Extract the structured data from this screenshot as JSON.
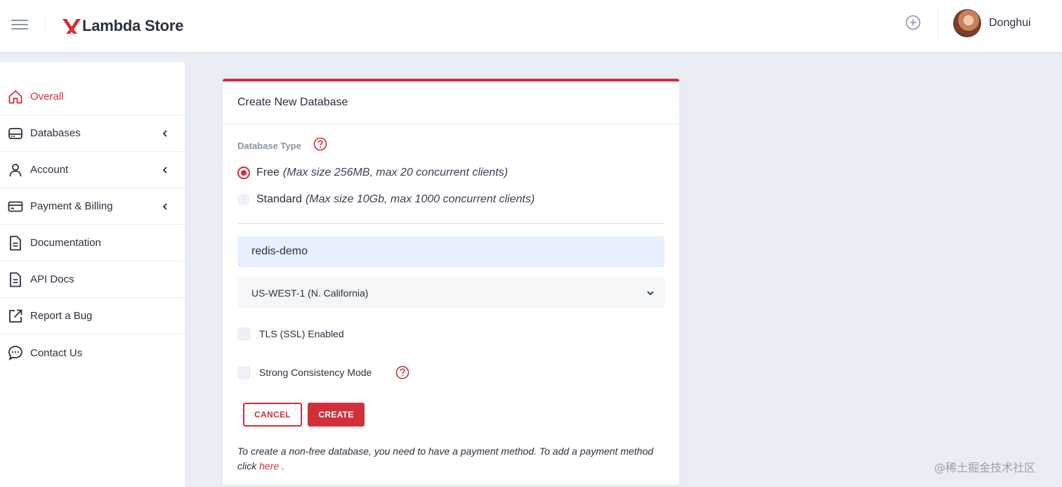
{
  "colors": {
    "accent": "#d1303b",
    "background": "#eaedf4",
    "text": "#2b3140"
  },
  "header": {
    "menu_icon": "hamburger-icon",
    "app_name": "Lambda Store",
    "add_icon": "plus-circle-icon",
    "user_name": "Donghui"
  },
  "sidebar": {
    "items": [
      {
        "label": "Overall",
        "icon": "home-icon",
        "active": true,
        "expandable": false
      },
      {
        "label": "Databases",
        "icon": "database-icon",
        "active": false,
        "expandable": true
      },
      {
        "label": "Account",
        "icon": "user-icon",
        "active": false,
        "expandable": true
      },
      {
        "label": "Payment & Billing",
        "icon": "credit-card-icon",
        "active": false,
        "expandable": true
      },
      {
        "label": "Documentation",
        "icon": "document-icon",
        "active": false,
        "expandable": false
      },
      {
        "label": "API Docs",
        "icon": "document-icon",
        "active": false,
        "expandable": false
      },
      {
        "label": "Report a Bug",
        "icon": "external-link-icon",
        "active": false,
        "expandable": false
      },
      {
        "label": "Contact Us",
        "icon": "chat-icon",
        "active": false,
        "expandable": false
      }
    ]
  },
  "form": {
    "title": "Create New Database",
    "type_label": "Database Type",
    "types": [
      {
        "name": "Free",
        "description": "(Max size 256MB, max 20 concurrent clients)",
        "selected": true
      },
      {
        "name": "Standard",
        "description": "(Max size 10Gb, max 1000 concurrent clients)",
        "selected": false
      }
    ],
    "name_value": "redis-demo",
    "region_value": "US-WEST-1 (N. California)",
    "tls_label": "TLS (SSL) Enabled",
    "tls_checked": false,
    "consistency_label": "Strong Consistency Mode",
    "consistency_checked": false,
    "cancel_label": "CANCEL",
    "create_label": "CREATE",
    "note_text": "To create a non-free database, you need to have a payment method. To add a payment method click",
    "note_link": "here",
    "note_end": "."
  },
  "watermark": "@稀土掘金技术社区"
}
